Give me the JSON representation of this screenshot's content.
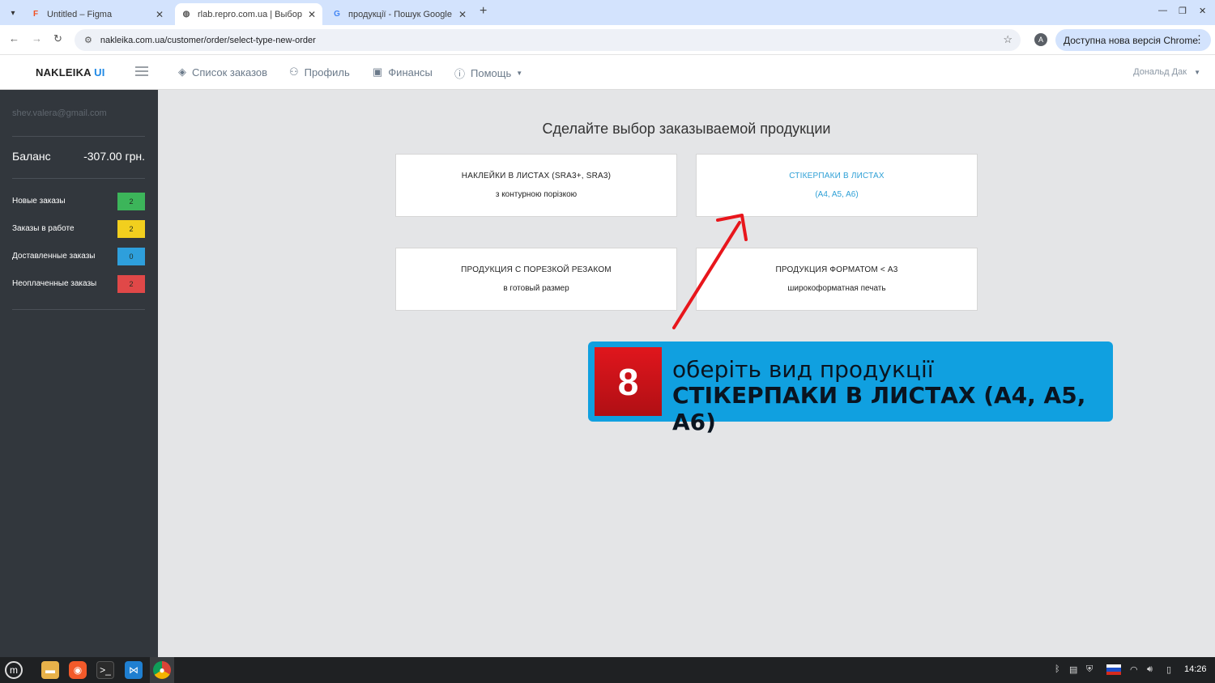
{
  "browser": {
    "tabs": [
      {
        "title": "Untitled – Figma",
        "favicon": "figma-icon",
        "active": false
      },
      {
        "title": "rlab.repro.com.ua | Выбор т...",
        "favicon": "globe-icon",
        "active": true
      },
      {
        "title": "продукції - Пошук Google",
        "favicon": "google-icon",
        "active": false
      }
    ],
    "url": "nakleika.com.ua/customer/order/select-type-new-order",
    "profile_initial": "A",
    "update_label": "Доступна нова версія Chrome"
  },
  "header": {
    "brand": "NAKLEIKA",
    "brand_suffix": "UI",
    "nav": [
      {
        "label": "Список заказов",
        "icon": "layers-icon"
      },
      {
        "label": "Профиль",
        "icon": "user-gear-icon"
      },
      {
        "label": "Финансы",
        "icon": "wallet-icon"
      },
      {
        "label": "Помощь",
        "icon": "help-circle-icon"
      }
    ],
    "user": "Дональд Дак"
  },
  "sidebar": {
    "email": "shev.valera@gmail.com",
    "balance_label": "Баланс",
    "balance_value": "-307.00 грн.",
    "items": [
      {
        "label": "Новые заказы",
        "count": "2",
        "color": "#3cb55a"
      },
      {
        "label": "Заказы в работе",
        "count": "2",
        "color": "#f2cf1e"
      },
      {
        "label": "Доставленные заказы",
        "count": "0",
        "color": "#2e9fdc"
      },
      {
        "label": "Неоплаченные заказы",
        "count": "2",
        "color": "#e04848"
      }
    ]
  },
  "main": {
    "heading": "Сделайте выбор заказываемой продукции",
    "cards": [
      {
        "title": "НАКЛЕЙКИ В ЛИСТАХ (SRA3+, SRA3)",
        "subtitle": "з контурною порізкою",
        "highlighted": false
      },
      {
        "title": "СТІКЕРПАКИ В ЛИСТАХ",
        "subtitle": "(A4, A5, A6)",
        "highlighted": true
      },
      {
        "title": "ПРОДУКЦИЯ С ПОРЕЗКОЙ РЕЗАКОМ",
        "subtitle": "в готовый размер",
        "highlighted": false
      },
      {
        "title": "ПРОДУКЦИЯ ФОРМАТОМ < A3",
        "subtitle": "широкоформатная печать",
        "highlighted": false
      }
    ]
  },
  "callout": {
    "step": "8",
    "line1": "оберіть вид продукції",
    "line2": "СТІКЕРПАКИ В ЛИСТАХ (A4, A5, A6)",
    "color": "#10a0e0"
  },
  "taskbar": {
    "apps": [
      "mint-menu-icon",
      "files-icon",
      "firefox-icon",
      "terminal-icon",
      "vscode-icon",
      "chrome-icon"
    ],
    "time": "14:26"
  },
  "colors": {
    "accent": "#2ea0d6",
    "sidebar_bg": "#32373d",
    "arrow": "#e8161c"
  }
}
